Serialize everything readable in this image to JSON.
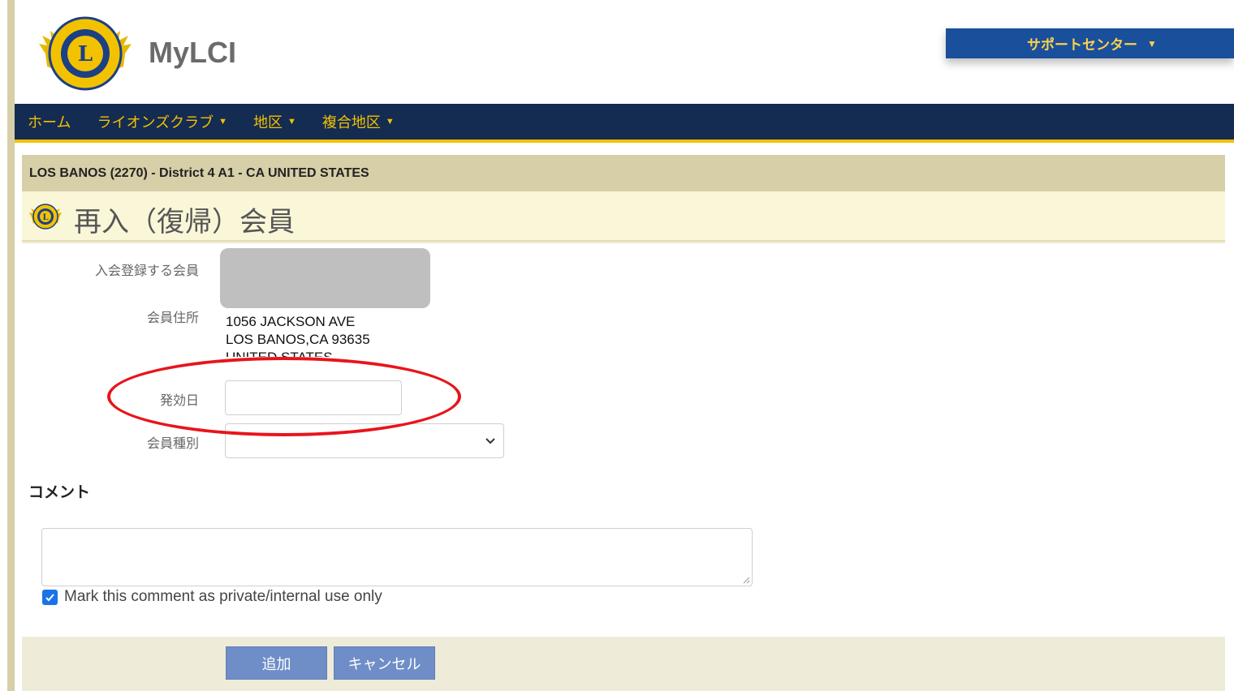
{
  "header": {
    "app_title": "MyLCI",
    "support_label": "サポートセンター"
  },
  "nav": {
    "items": [
      {
        "label": "ホーム",
        "has_dropdown": false
      },
      {
        "label": "ライオンズクラブ",
        "has_dropdown": true
      },
      {
        "label": "地区",
        "has_dropdown": true
      },
      {
        "label": "複合地区",
        "has_dropdown": true
      }
    ]
  },
  "club_bar": {
    "text": "LOS BANOS (2270) - District 4 A1 - CA UNITED STATES"
  },
  "page": {
    "title": "再入（復帰）会員"
  },
  "form": {
    "member_label": "入会登録する会員",
    "address_label": "会員住所",
    "address_lines": [
      "1056 JACKSON AVE",
      "LOS BANOS,CA 93635",
      "UNITED STATES"
    ],
    "effective_date_label": "発効日",
    "effective_date_value": "",
    "member_type_label": "会員種別",
    "member_type_value": ""
  },
  "comment": {
    "heading": "コメント",
    "value": "",
    "private_checkbox_label": "Mark this comment as private/internal use only",
    "private_checked": true
  },
  "actions": {
    "add_label": "追加",
    "cancel_label": "キャンセル"
  },
  "colors": {
    "nav_bg": "#142b52",
    "nav_text": "#f2c200",
    "support_bg": "#1a4f9c",
    "button_bg": "#6f8ec7",
    "highlight": "#e8141b"
  }
}
